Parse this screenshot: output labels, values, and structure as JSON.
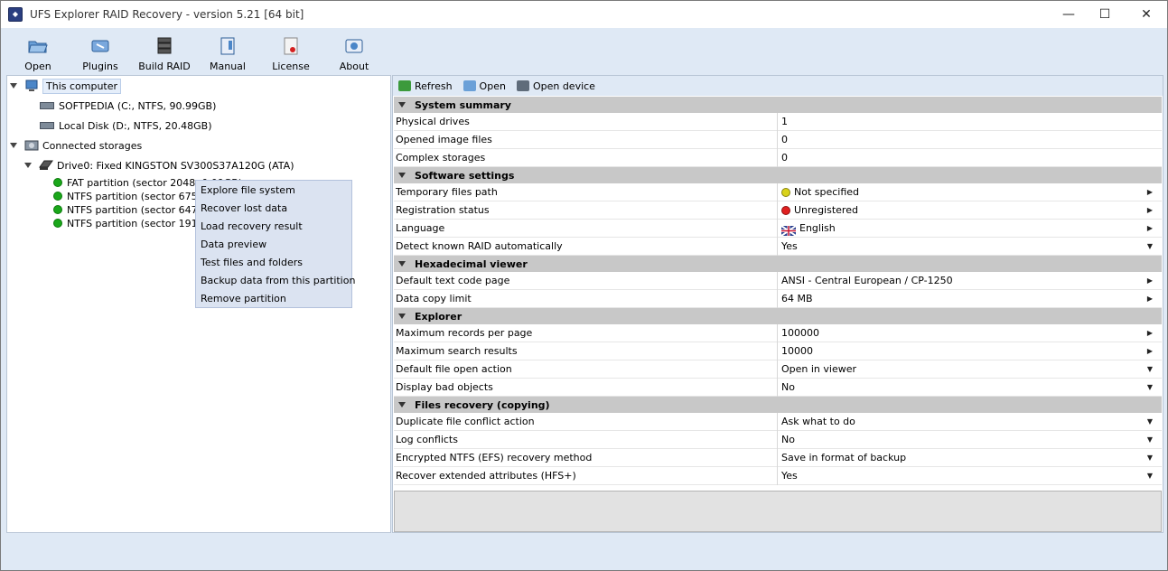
{
  "window": {
    "title": "UFS Explorer RAID Recovery - version 5.21 [64 bit]"
  },
  "toolbar": {
    "items": [
      {
        "label": "Open",
        "icon": "folder-open-icon"
      },
      {
        "label": "Plugins",
        "icon": "plugins-icon"
      },
      {
        "label": "Build RAID",
        "icon": "raid-icon"
      },
      {
        "label": "Manual",
        "icon": "manual-icon"
      },
      {
        "label": "License",
        "icon": "license-icon"
      },
      {
        "label": "About",
        "icon": "about-icon"
      }
    ]
  },
  "tree": {
    "this_computer": "This computer",
    "drive_c": "SOFTPEDIA (C:, NTFS, 90.99GB)",
    "drive_d": "Local Disk (D:, NTFS, 20.48GB)",
    "connected": "Connected storages",
    "drive0": "Drive0: Fixed KINGSTON SV300S37A120G (ATA)",
    "partitions": [
      "FAT partition (sector 2048, 0.09GB)",
      "NTFS partition (sector 67584,",
      "NTFS partition (sector 647168",
      "NTFS partition (sector 191490"
    ]
  },
  "context_menu": {
    "items": [
      "Explore file system",
      "Recover lost data",
      "Load recovery result",
      "Data preview",
      "Test files and folders",
      "Backup data from this partition",
      "Remove partition"
    ]
  },
  "right_toolbar": {
    "refresh": "Refresh",
    "open": "Open",
    "open_device": "Open device"
  },
  "sections": {
    "system_summary": "System summary",
    "software_settings": "Software settings",
    "hex_viewer": "Hexadecimal viewer",
    "explorer": "Explorer",
    "files_recovery": "Files recovery (copying)"
  },
  "props": {
    "physical_drives": {
      "name": "Physical drives",
      "value": "1"
    },
    "opened_images": {
      "name": "Opened image files",
      "value": "0"
    },
    "complex_storages": {
      "name": "Complex storages",
      "value": "0"
    },
    "temp_path": {
      "name": "Temporary files path",
      "value": "Not specified"
    },
    "reg_status": {
      "name": "Registration status",
      "value": "Unregistered"
    },
    "language": {
      "name": "Language",
      "value": "English"
    },
    "detect_raid": {
      "name": "Detect known RAID automatically",
      "value": "Yes"
    },
    "code_page": {
      "name": "Default text code page",
      "value": "ANSI - Central European / CP-1250"
    },
    "copy_limit": {
      "name": "Data copy limit",
      "value": "64 MB"
    },
    "max_records": {
      "name": "Maximum records per page",
      "value": "100000"
    },
    "max_search": {
      "name": "Maximum search results",
      "value": "10000"
    },
    "open_action": {
      "name": "Default file open action",
      "value": "Open in viewer"
    },
    "bad_objects": {
      "name": "Display bad objects",
      "value": "No"
    },
    "dup_conflict": {
      "name": "Duplicate file conflict action",
      "value": "Ask what to do"
    },
    "log_conflicts": {
      "name": "Log conflicts",
      "value": "No"
    },
    "efs_method": {
      "name": "Encrypted NTFS (EFS) recovery method",
      "value": "Save in format of backup"
    },
    "ext_attrs": {
      "name": "Recover extended attributes (HFS+)",
      "value": "Yes"
    }
  },
  "colors": {
    "accent": "#dfe9f5",
    "section": "#c8c8c8",
    "status_yellow": "#d9d21a",
    "status_red": "#e02020",
    "status_green": "#1aa71a"
  }
}
